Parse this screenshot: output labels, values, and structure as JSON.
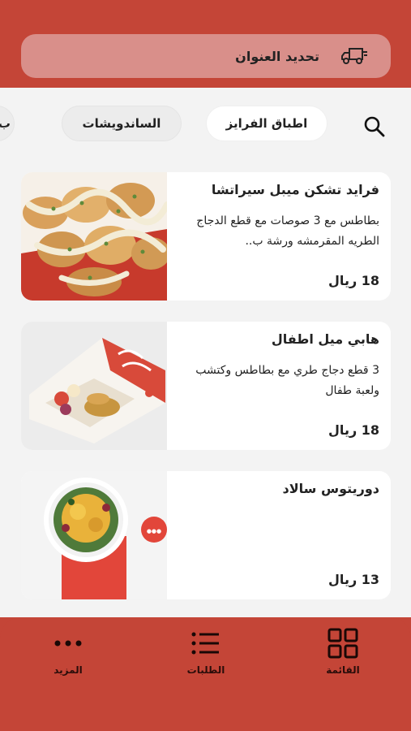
{
  "address": {
    "label": "تحديد العنوان",
    "icon": "delivery-truck-icon"
  },
  "search": {
    "icon": "search-icon"
  },
  "categories": [
    {
      "label": "اطباق الفرايز",
      "active": true
    },
    {
      "label": "الساندويشات",
      "active": false
    },
    {
      "label": "ب",
      "active": false
    }
  ],
  "menu": [
    {
      "title": "فرايد تشكن ميبل سيراتشا",
      "description": "بطاطس مع 3 صوصات مع قطع الدجاج الطريه المقرمشه ورشة ب..",
      "price": "18 ريال"
    },
    {
      "title": "هابي ميل اطفال",
      "description": "3 قطع دجاج طري مع بطاطس وكتشب ولعبة طفال",
      "price": "18 ريال"
    },
    {
      "title": "دوريتوس سالاد",
      "description": "",
      "price": "13 ريال"
    }
  ],
  "nav": [
    {
      "label": "القائمة",
      "icon": "grid-menu-icon"
    },
    {
      "label": "الطلبات",
      "icon": "list-icon"
    },
    {
      "label": "المزيد",
      "icon": "more-dots-icon"
    }
  ],
  "colors": {
    "brand": "#c44537",
    "address_bar": "#d98f8a",
    "background": "#f3f3f3"
  }
}
